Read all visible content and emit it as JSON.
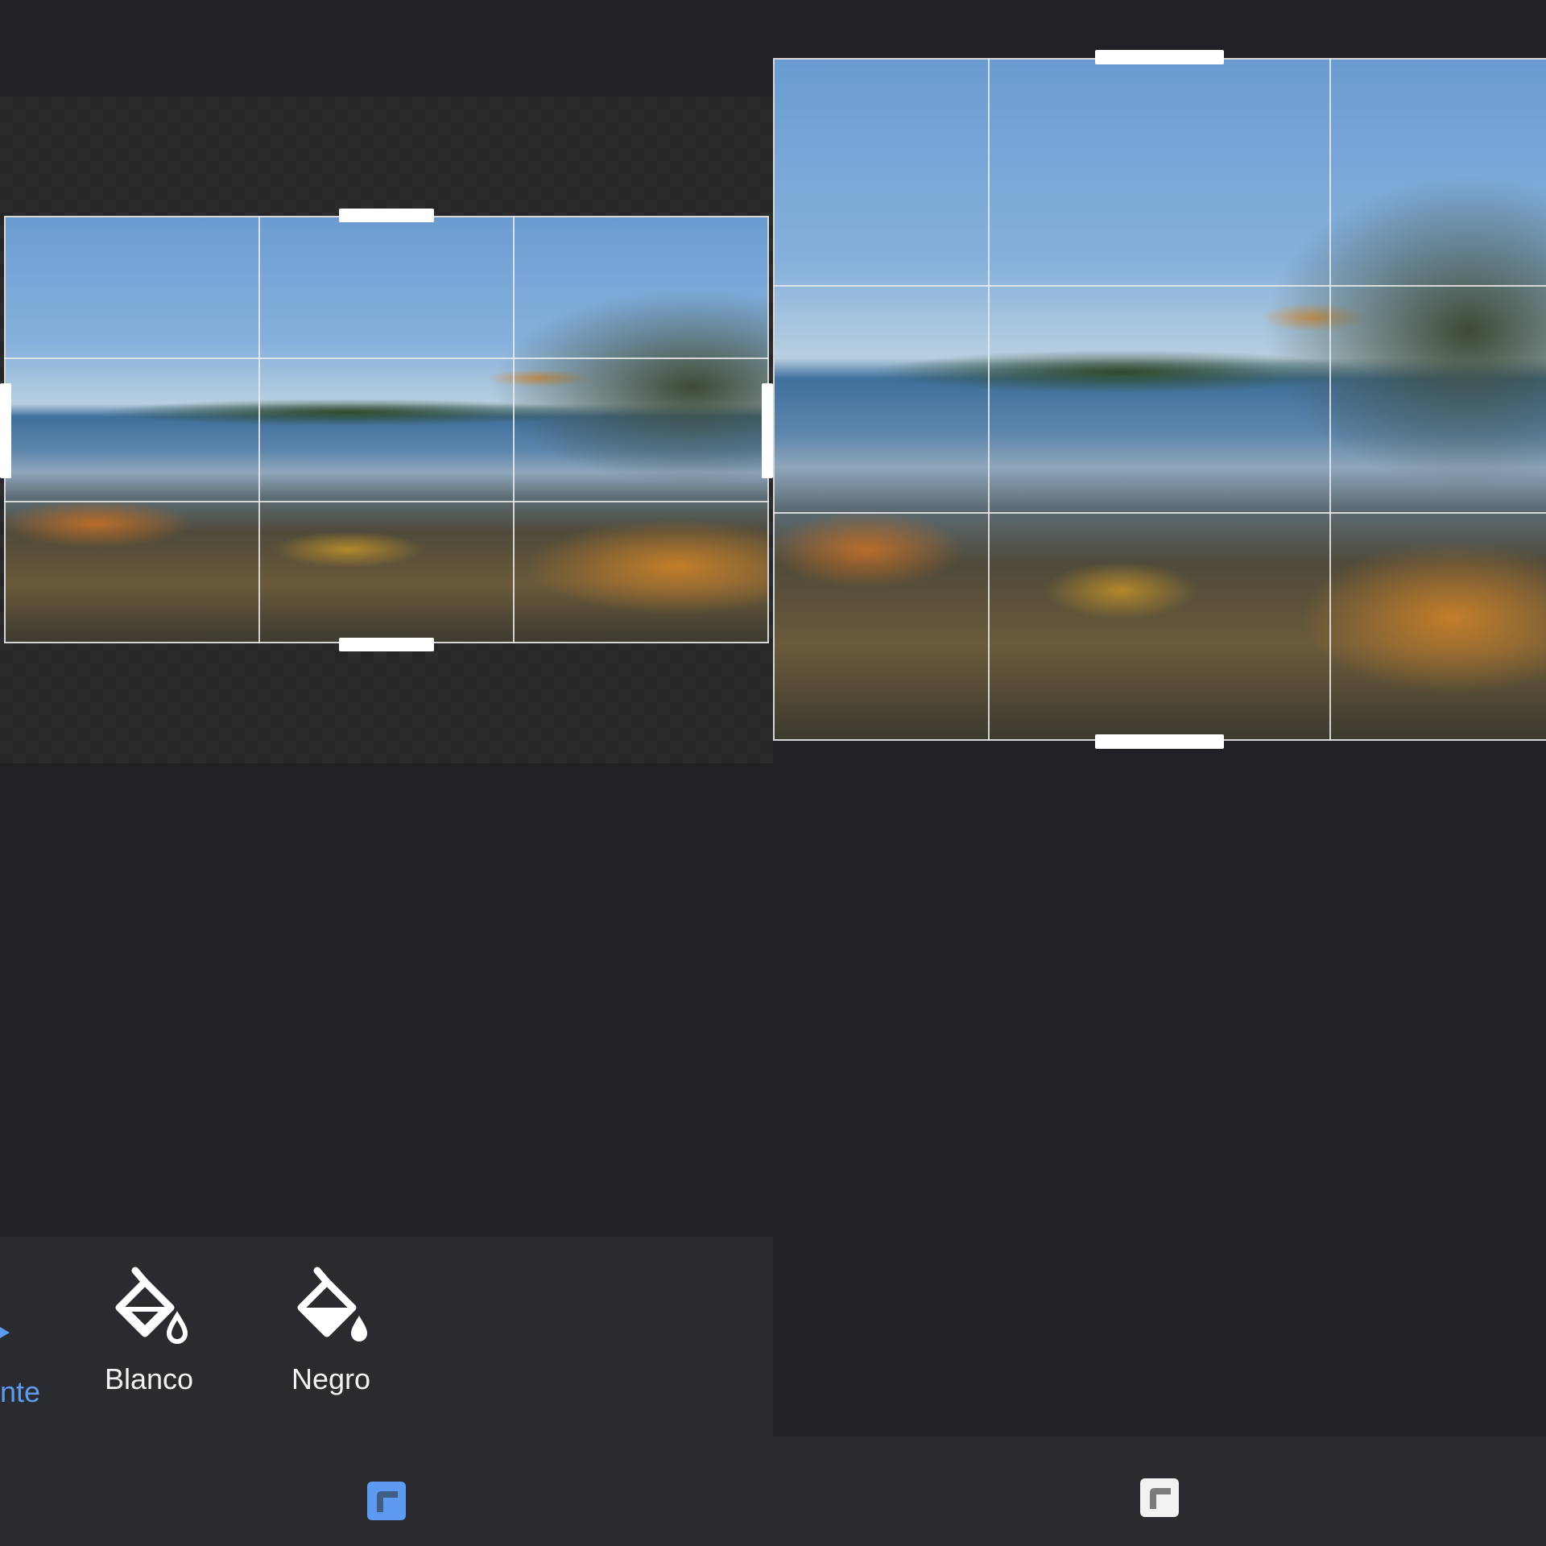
{
  "left_panel": {
    "tools": [
      {
        "label": "Blanco",
        "icon": "paint-bucket-outline-icon"
      },
      {
        "label": "Negro",
        "icon": "paint-bucket-filled-icon"
      }
    ],
    "partial_tool": {
      "label": "nte",
      "icon": "arrow-icon",
      "state": "selected"
    },
    "bottom_icon": {
      "icon": "aspect-ratio-icon",
      "state": "active"
    }
  },
  "right_panel": {
    "bottom_icon": {
      "icon": "aspect-ratio-icon",
      "state": "inactive"
    }
  },
  "colors": {
    "background": "#202125",
    "toolbar": "#2a2b2f",
    "accent": "#5c9bf0",
    "text": "#f2f2f2"
  }
}
